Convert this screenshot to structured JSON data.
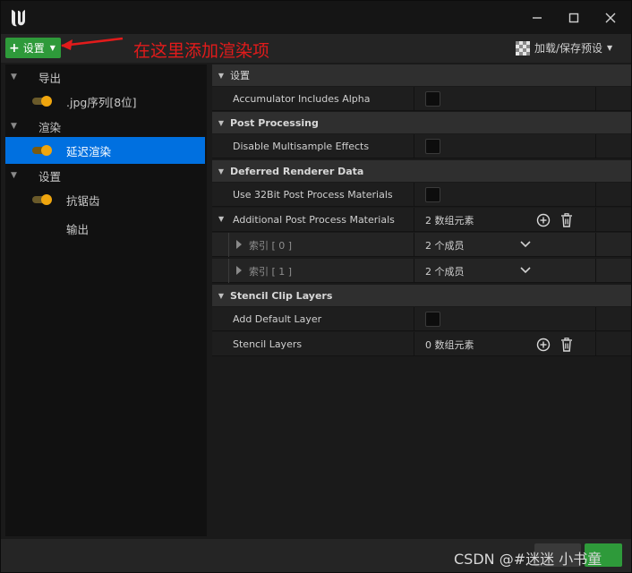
{
  "toolbar": {
    "add_settings_label": "设置",
    "annotation_text": "在这里添加渲染项",
    "preset_label": "加载/保存预设"
  },
  "tree": [
    {
      "label": "导出",
      "kind": "category"
    },
    {
      "label": ".jpg序列[8位]",
      "kind": "item",
      "toggle": true
    },
    {
      "label": "渲染",
      "kind": "category"
    },
    {
      "label": "延迟渲染",
      "kind": "item",
      "toggle": true,
      "selected": true
    },
    {
      "label": "设置",
      "kind": "category"
    },
    {
      "label": "抗锯齿",
      "kind": "item",
      "toggle": true
    },
    {
      "label": "输出",
      "kind": "item",
      "toggle": false
    }
  ],
  "details": {
    "sections": [
      {
        "title": "设置"
      },
      {
        "title": "Post Processing"
      },
      {
        "title": "Deferred Renderer Data"
      },
      {
        "title": "Stencil Clip Layers"
      }
    ],
    "props": {
      "accumulator": "Accumulator Includes Alpha",
      "disable_msaa": "Disable Multisample Effects",
      "use_32bit": "Use 32Bit Post Process Materials",
      "additional_materials": "Additional Post Process Materials",
      "additional_materials_value": "2 数组元素",
      "index0": "索引 [ 0 ]",
      "index0_value": "2 个成员",
      "index1": "索引 [ 1 ]",
      "index1_value": "2 个成员",
      "add_default_layer": "Add Default Layer",
      "stencil_layers": "Stencil Layers",
      "stencil_layers_value": "0 数组元素"
    }
  },
  "bottom": {
    "watermark": "CSDN @#迷迷 小书童"
  },
  "colors": {
    "accent_green": "#2e9a3a",
    "selection_blue": "#0070e0",
    "toggle_on": "#f0a60e",
    "annotation_red": "#e21b1b"
  }
}
